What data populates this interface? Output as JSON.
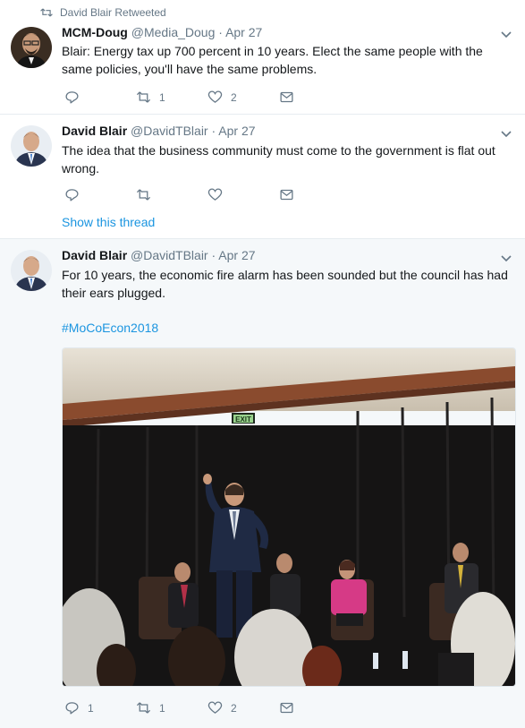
{
  "tweets": [
    {
      "retweet_label": "David Blair Retweeted",
      "name": "MCM-Doug",
      "handle": "@Media_Doug",
      "separator": "·",
      "time": "Apr 27",
      "text": "Blair: Energy tax up 700 percent in 10 years. Elect the same people with the same policies, you'll have the same problems.",
      "reply_count": "",
      "retweet_count": "1",
      "like_count": "2",
      "icons": {
        "reply": "reply-icon",
        "retweet": "retweet-icon",
        "like": "heart-icon",
        "dm": "mail-icon"
      }
    },
    {
      "name": "David Blair",
      "handle": "@DavidTBlair",
      "separator": "·",
      "time": "Apr 27",
      "text": "The idea that the business community must come to the government is flat out wrong.",
      "reply_count": "",
      "retweet_count": "",
      "like_count": "",
      "show_thread": "Show this thread"
    },
    {
      "name": "David Blair",
      "handle": "@DavidTBlair",
      "separator": "·",
      "time": "Apr 27",
      "text": "For 10 years, the economic fire alarm has been sounded but the council has had their ears plugged.",
      "hashtag": "#MoCoEcon2018",
      "photo_sign": "EXIT",
      "reply_count": "1",
      "retweet_count": "1",
      "like_count": "2"
    }
  ],
  "colors": {
    "link": "#1b95e0",
    "secondary": "#657786",
    "highlight_bg": "#f5f8fa",
    "divider": "#e6ecf0"
  }
}
